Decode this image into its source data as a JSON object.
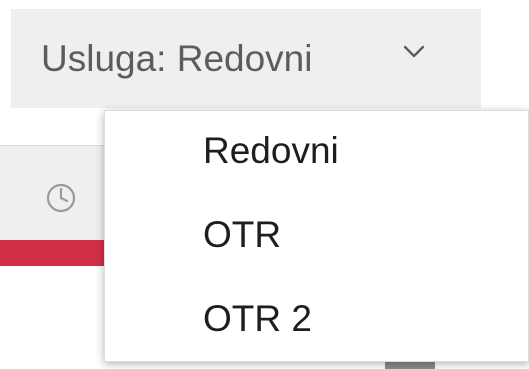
{
  "dropdown": {
    "label": "Usluga: Redovni",
    "icon": "chevron-down-icon"
  },
  "menu": {
    "items": [
      {
        "label": "Redovni"
      },
      {
        "label": "OTR"
      },
      {
        "label": "OTR 2"
      }
    ]
  },
  "background": {
    "icon": "clock-icon",
    "accent_color": "#d12f47"
  }
}
